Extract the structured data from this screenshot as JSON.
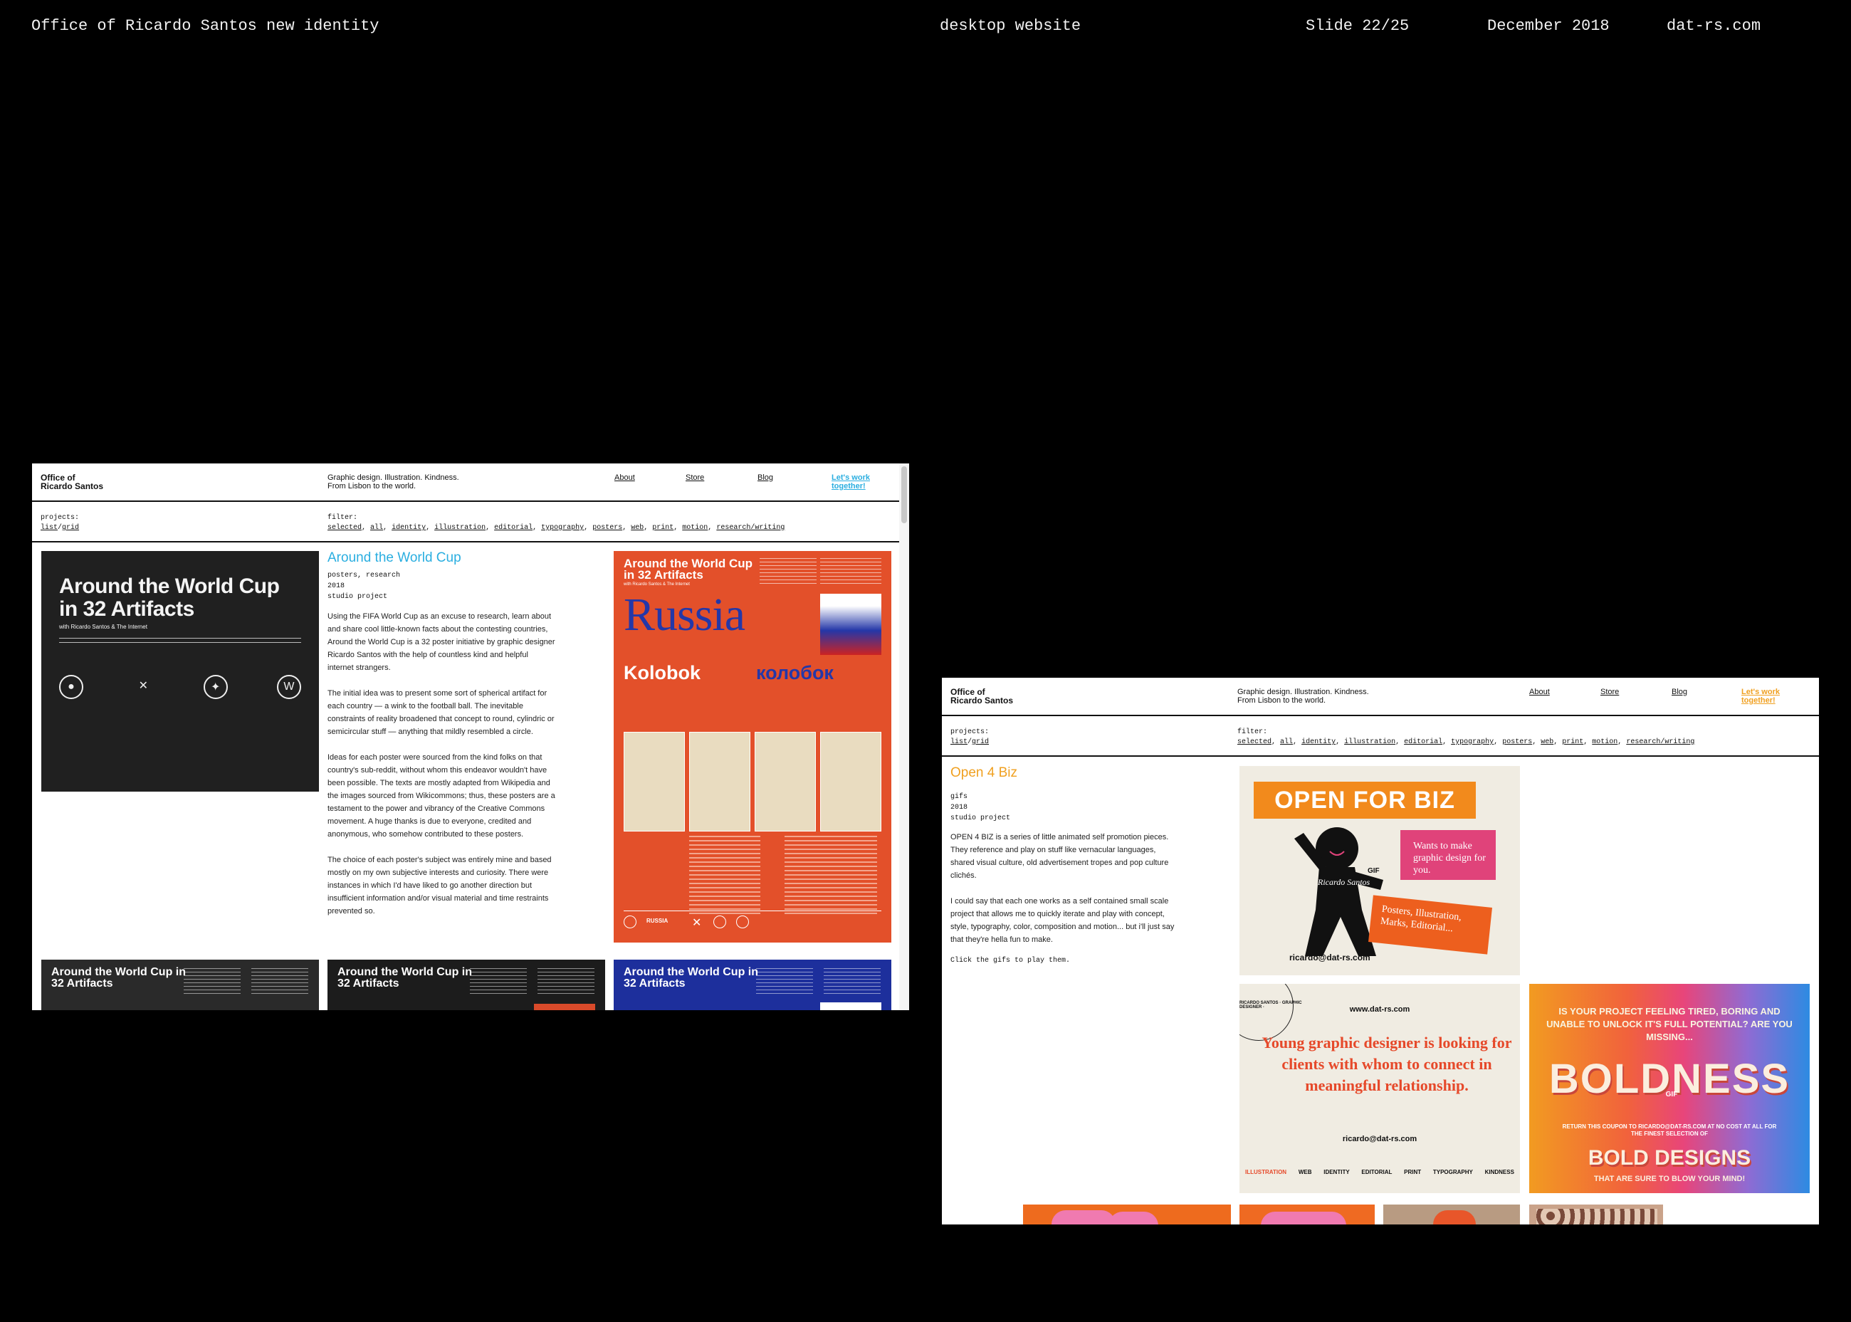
{
  "slide_header": {
    "project": "Office of Ricardo Santos new identity",
    "context": "desktop website",
    "slide": "Slide 22/25",
    "date": "December 2018",
    "site": "dat-rs.com"
  },
  "colors": {
    "background": "#000000",
    "window_bg": "#ffffff",
    "accent_blue": "#2aaee0",
    "accent_orange": "#f0a020"
  },
  "window1": {
    "logo": [
      "Office of",
      "Ricardo Santos"
    ],
    "tagline": [
      "Graphic design. Illustration. Kindness.",
      "From Lisbon to the world."
    ],
    "nav": [
      "About",
      "Store",
      "Blog"
    ],
    "cta": [
      "Let's work",
      "together!"
    ],
    "filterbar": {
      "projects_label": "projects:",
      "view_list": "list",
      "view_grid": "grid",
      "filter_label": "filter:",
      "filters": [
        "selected",
        "all",
        "identity",
        "illustration",
        "editorial",
        "typography",
        "posters",
        "web",
        "print",
        "motion",
        "research/writing"
      ]
    },
    "project": {
      "title": "Around the World Cup",
      "meta": [
        "posters, research",
        "2018",
        "studio project"
      ],
      "paragraphs": [
        "Using the FIFA World Cup as an excuse to research, learn about and share cool little-known facts about the contesting countries, Around the World Cup is a 32 poster initiative by graphic designer Ricardo Santos with the help of countless kind and helpful internet strangers.",
        "The initial idea was to present some sort of spherical artifact for each country — a wink to the football ball. The inevitable constraints of reality broadened that concept to round, cylindric or semicircular stuff — anything that mildly resembled a circle.",
        "Ideas for each poster were sourced from the kind folks on that country's sub-reddit, without whom this endeavor wouldn't have been possible. The texts are mostly adapted from Wikipedia and the images sourced from Wikicommons; thus, these posters are a testament to the power and vibrancy of the Creative Commons movement. A huge thanks is due to everyone, credited and anonymous, who somehow contributed to these posters.",
        "The choice of each poster's subject was entirely mine and based mostly on my own subjective interests and curiosity. There were instances in which I'd have liked to go another direction but insufficient information and/or visual material and time restraints prevented so."
      ]
    },
    "poster_cover": {
      "title": "Around the World Cup in 32 Artifacts",
      "subtitle": "with Ricardo Santos & The Internet"
    },
    "poster_russia": {
      "header": "Around the World Cup in 32 Artifacts",
      "subheader": "with Ricardo Santos & The Internet",
      "country": "Russia",
      "artifact_en": "Kolobok",
      "artifact_ru": "колобок",
      "footer": "RUSSIA"
    },
    "strip_posters": [
      "Around the World Cup in 32 Artifacts",
      "Around the World Cup in 32 Artifacts",
      "Around the World Cup in 32 Artifacts"
    ]
  },
  "window2": {
    "logo": [
      "Office of",
      "Ricardo Santos"
    ],
    "tagline": [
      "Graphic design. Illustration. Kindness.",
      "From Lisbon to the world."
    ],
    "nav": [
      "About",
      "Store",
      "Blog"
    ],
    "cta": [
      "Let's work",
      "together!"
    ],
    "filterbar": {
      "projects_label": "projects:",
      "view_list": "list",
      "view_grid": "grid",
      "filter_label": "filter:",
      "filters": [
        "selected",
        "all",
        "identity",
        "illustration",
        "editorial",
        "typography",
        "posters",
        "web",
        "print",
        "motion",
        "research/writing"
      ]
    },
    "project": {
      "title": "Open 4 Biz",
      "meta": [
        "gifs",
        "2018",
        "studio project"
      ],
      "paragraphs": [
        "OPEN 4 BIZ is a series of little animated self promotion pieces. They reference and play on stuff like vernacular languages, shared visual culture, old advertisement tropes and pop culture clichés.",
        "I could say that each one works as a self contained small scale project that allows me to quickly iterate and play with concept, style, typography, color, composition and motion... but i'll just say that they're hella fun to make."
      ],
      "hint": "Click the gifs to play them."
    },
    "card_biz": {
      "banner": "OPEN FOR BIZ",
      "pink": "Wants to make graphic design for you.",
      "orange": "Posters, Illustration, Marks, Editorial...",
      "gif": "GIF",
      "signature": "Ricardo Santos",
      "email": "ricardo@dat-rs.com"
    },
    "card_young": {
      "ring": "RICARDO SANTOS · GRAPHIC DESIGNER ·",
      "url": "www.dat-rs.com",
      "headline": "Young graphic designer is looking for clients with whom to connect in meaningful relationship.",
      "email": "ricardo@dat-rs.com",
      "footer": [
        "ILLUSTRATION",
        "WEB",
        "IDENTITY",
        "EDITORIAL",
        "PRINT",
        "TYPOGRAPHY",
        "KINDNESS"
      ]
    },
    "card_bold": {
      "top": "IS YOUR PROJECT FEELING TIRED, BORING AND UNABLE TO UNLOCK IT'S FULL POTENTIAL? ARE YOU MISSING...",
      "big": "BOLDNESS",
      "gif": "GIF",
      "small": "RETURN THIS COUPON TO RICARDO@DAT-RS.COM AT NO COST AT ALL FOR THE FINEST SELECTION OF",
      "bottom": "BOLD DESIGNS",
      "tag": "THAT ARE SURE TO BLOW YOUR MIND!"
    }
  }
}
